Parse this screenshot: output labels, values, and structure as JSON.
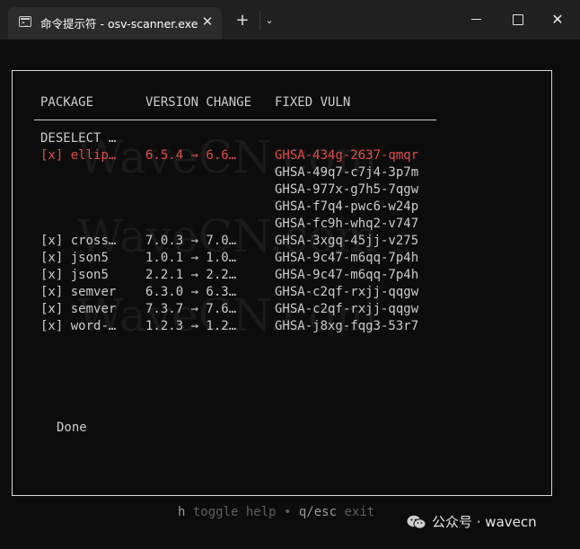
{
  "window": {
    "tab_title": "命令提示符 - osv-scanner.exe",
    "tab_icon_glyph": ">_",
    "tab_close": "✕",
    "new_tab": "+",
    "tab_dropdown": "⌄",
    "close_glyph": "✕"
  },
  "table": {
    "headers": {
      "package": "PACKAGE",
      "version_change": "VERSION CHANGE",
      "fixed_vuln": "FIXED VULN"
    },
    "deselect_label": "DESELECT …",
    "rows": [
      {
        "check": "[x]",
        "package": "ellip…",
        "version": "6.5.4 → 6.6…",
        "vulns": [
          "GHSA-434g-2637-qmqr",
          "GHSA-49q7-c7j4-3p7m",
          "GHSA-977x-g7h5-7qgw",
          "GHSA-f7q4-pwc6-w24p",
          "GHSA-fc9h-whq2-v747"
        ],
        "highlighted": true
      },
      {
        "check": "[x]",
        "package": "cross…",
        "version": "7.0.3 → 7.0…",
        "vulns": [
          "GHSA-3xgq-45jj-v275"
        ]
      },
      {
        "check": "[x]",
        "package": "json5",
        "version": "1.0.1 → 1.0…",
        "vulns": [
          "GHSA-9c47-m6qq-7p4h"
        ]
      },
      {
        "check": "[x]",
        "package": "json5",
        "version": "2.2.1 → 2.2…",
        "vulns": [
          "GHSA-9c47-m6qq-7p4h"
        ]
      },
      {
        "check": "[x]",
        "package": "semver",
        "version": "6.3.0 → 6.3…",
        "vulns": [
          "GHSA-c2qf-rxjj-qqgw"
        ]
      },
      {
        "check": "[x]",
        "package": "semver",
        "version": "7.3.7 → 7.6…",
        "vulns": [
          "GHSA-c2qf-rxjj-qqgw"
        ]
      },
      {
        "check": "[x]",
        "package": "word-…",
        "version": "1.2.3 → 1.2…",
        "vulns": [
          "GHSA-j8xg-fqg3-53r7"
        ]
      }
    ],
    "done_label": "Done"
  },
  "help": {
    "key1": "h",
    "label1": " toggle help ",
    "sep": "•",
    "key2": " q/esc",
    "label2": " exit"
  },
  "overlay": {
    "watermark": "WaveCN.com",
    "wechat_label": "公众号 · wavecn"
  },
  "colors": {
    "highlight": "#e24a4a",
    "text": "#cccccc",
    "background": "#0c0c0c"
  }
}
